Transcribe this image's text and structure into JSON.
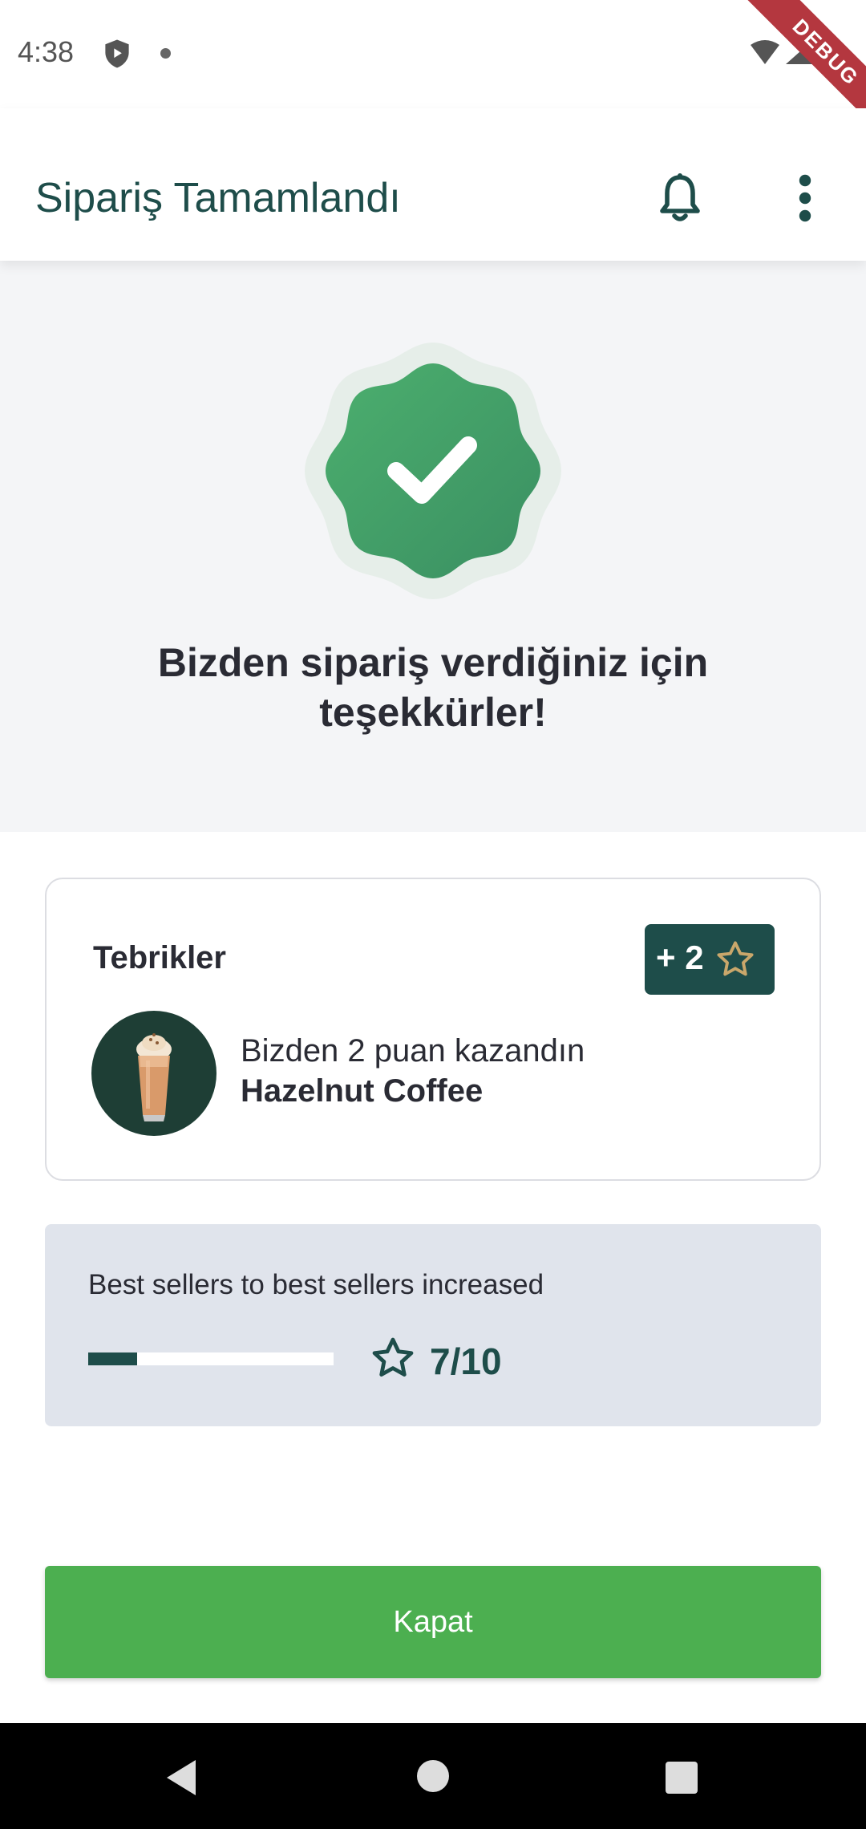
{
  "status_bar": {
    "time": "4:38",
    "icons": [
      "shield-icon",
      "notification-dot-icon",
      "wifi-icon",
      "signal-icon",
      "battery-icon"
    ],
    "debug_label": "DEBUG"
  },
  "app_bar": {
    "title": "Sipariş Tamamlandı",
    "actions": [
      "bell-icon",
      "more-vert-icon"
    ]
  },
  "hero": {
    "icon": "verified-check-icon",
    "message": "Bizden sipariş verdiğiniz için teşekkürler!"
  },
  "reward_card": {
    "title": "Tebrikler",
    "points_badge": "+ 2",
    "points_icon": "star-outline-icon",
    "earned_text": "Bizden 2 puan kazandın",
    "product_name": "Hazelnut Coffee",
    "product_image": "iced-coffee-image"
  },
  "progress": {
    "label": "Best sellers to best sellers increased",
    "fill_fraction": 0.2,
    "count_text": "7/10",
    "icon": "star-outline-icon"
  },
  "close_button": {
    "label": "Kapat"
  },
  "colors": {
    "primary": "#1e4d4a",
    "success": "#4caf50",
    "badge_green": "#3f9e64",
    "star_gold": "#c9a76b"
  }
}
